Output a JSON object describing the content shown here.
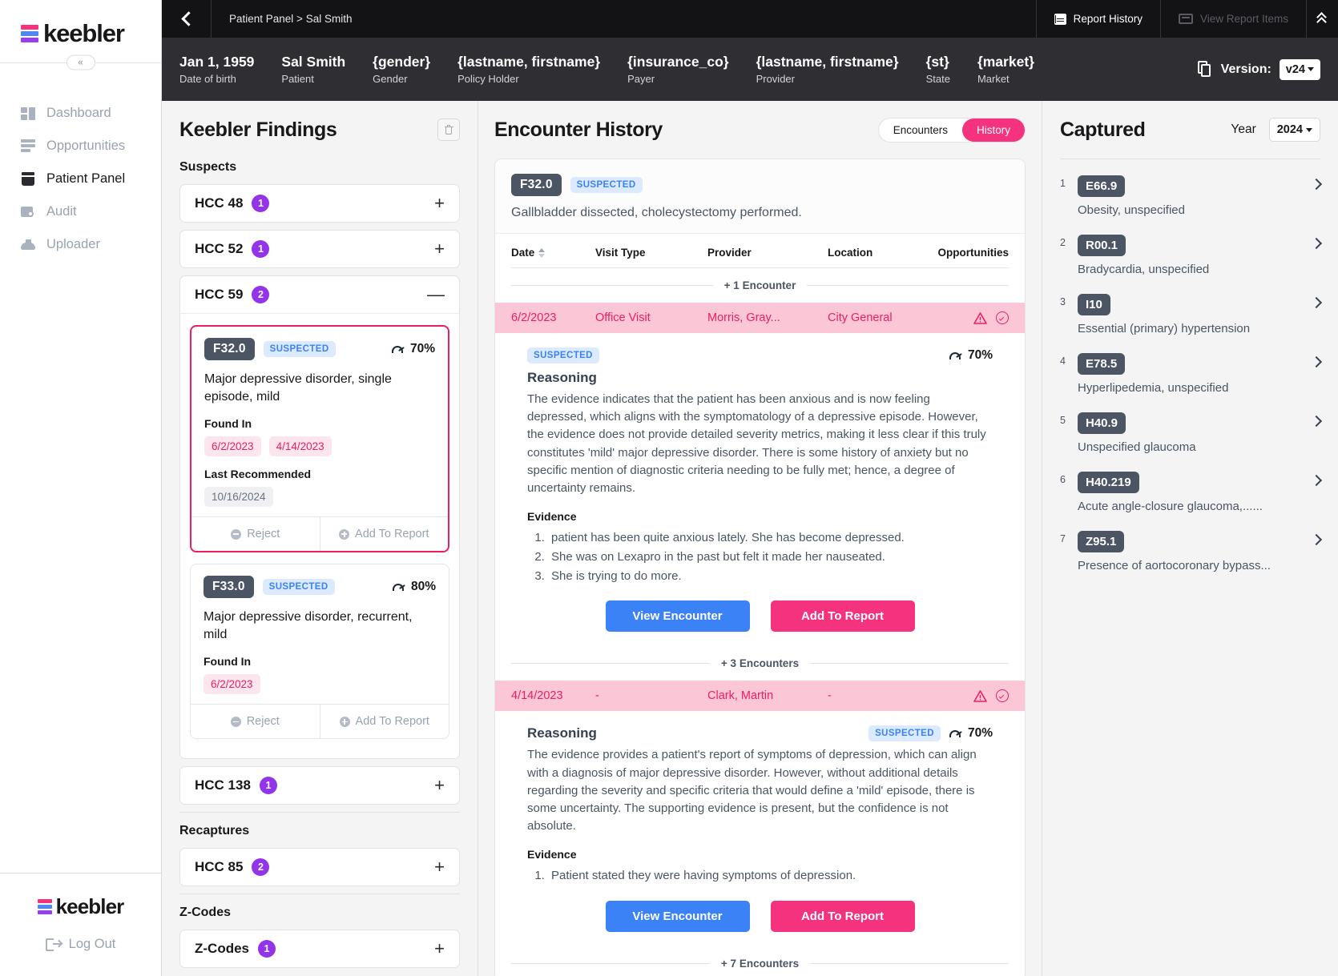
{
  "sidebar": {
    "logo_text": "keebler",
    "collapse_icon": "chevron-double-left-icon",
    "items": [
      {
        "label": "Dashboard",
        "icon": "dashboard-icon"
      },
      {
        "label": "Opportunities",
        "icon": "opportunities-icon"
      },
      {
        "label": "Patient Panel",
        "icon": "patient-panel-icon"
      },
      {
        "label": "Audit",
        "icon": "audit-icon"
      },
      {
        "label": "Uploader",
        "icon": "uploader-icon"
      }
    ],
    "footer_logo_text": "keebler",
    "logout_label": "Log Out"
  },
  "topbar": {
    "back_icon": "chevron-left-icon",
    "breadcrumb": "Patient Panel > Sal Smith",
    "report_history_label": "Report History",
    "report_history_icon": "report-history-icon",
    "view_report_items_label": "View Report Items",
    "view_report_items_icon": "view-report-items-icon",
    "collapse_icon": "chevron-double-up-icon"
  },
  "patient": {
    "fields": [
      {
        "value": "Jan 1, 1959",
        "label": "Date of birth"
      },
      {
        "value": "Sal Smith",
        "label": "Patient"
      },
      {
        "value": "{gender}",
        "label": "Gender"
      },
      {
        "value": "{lastname, firstname}",
        "label": "Policy Holder"
      },
      {
        "value": "{insurance_co}",
        "label": "Payer"
      },
      {
        "value": "{lastname, firstname}",
        "label": "Provider"
      },
      {
        "value": "{st}",
        "label": "State"
      },
      {
        "value": "{market}",
        "label": "Market"
      }
    ],
    "version_icon": "documents-icon",
    "version_label": "Version:",
    "version_value": "v24"
  },
  "findings": {
    "title": "Keebler Findings",
    "trash_icon": "trash-icon",
    "sections": [
      {
        "label": "Suspects",
        "rows": [
          {
            "name": "HCC 48",
            "count": "1",
            "toggle": "+",
            "expanded": false
          },
          {
            "name": "HCC 52",
            "count": "1",
            "toggle": "+",
            "expanded": false
          },
          {
            "name": "HCC 59",
            "count": "2",
            "toggle": "—",
            "expanded": true
          },
          {
            "name": "HCC 138",
            "count": "1",
            "toggle": "+",
            "expanded": false
          }
        ]
      },
      {
        "label": "Recaptures",
        "rows": [
          {
            "name": "HCC 85",
            "count": "2",
            "toggle": "+",
            "expanded": false
          }
        ]
      },
      {
        "label": "Z-Codes",
        "rows": [
          {
            "name": "Z-Codes",
            "count": "1",
            "toggle": "+",
            "expanded": false
          }
        ]
      }
    ],
    "cards": [
      {
        "code": "F32.0",
        "status": "SUSPECTED",
        "confidence": "70%",
        "description": "Major depressive disorder, single episode, mild",
        "found_in_label": "Found In",
        "found_in": [
          "6/2/2023",
          "4/14/2023"
        ],
        "last_recommended_label": "Last Recommended",
        "last_recommended": "10/16/2024",
        "reject_label": "Reject",
        "add_label": "Add To Report",
        "selected": true
      },
      {
        "code": "F33.0",
        "status": "SUSPECTED",
        "confidence": "80%",
        "description": "Major depressive disorder, recurrent, mild",
        "found_in_label": "Found In",
        "found_in": [
          "6/2/2023"
        ],
        "last_recommended_label": "",
        "last_recommended": "",
        "reject_label": "Reject",
        "add_label": "Add To Report",
        "selected": false
      }
    ]
  },
  "history": {
    "title": "Encounter History",
    "tabs": [
      {
        "label": "Encounters",
        "active": false
      },
      {
        "label": "History",
        "active": true
      }
    ],
    "header": {
      "code": "F32.0",
      "status": "SUSPECTED",
      "note": "Gallbladder dissected, cholecystectomy performed."
    },
    "columns": [
      "Date",
      "Visit Type",
      "Provider",
      "Location",
      "Opportunities"
    ],
    "groups": [
      {
        "divider": "+ 1 Encounter",
        "row": {
          "date": "6/2/2023",
          "visit_type": "Office Visit",
          "provider": "Morris, Gray...",
          "location": "City General",
          "warn_icon": "warning-triangle-icon",
          "check_icon": "check-circle-icon"
        },
        "reasoning": {
          "status": "SUSPECTED",
          "status_position": "above",
          "confidence": "70%",
          "title": "Reasoning",
          "text": "The evidence indicates that the patient has been anxious and is now feeling depressed, which aligns with the symptomatology of a depressive episode. However, the evidence does not provide detailed severity metrics, making it less clear if this truly constitutes 'mild' major depressive disorder. There is some history of anxiety but no specific mention of diagnostic criteria needing to be fully met; hence, a degree of uncertainty remains.",
          "evidence_label": "Evidence",
          "evidence": [
            "patient has been quite anxious lately. She has become depressed.",
            "She was on Lexapro in the past but felt it made her nauseated.",
            "She is trying to do more."
          ],
          "view_label": "View Encounter",
          "add_label": "Add To Report"
        }
      },
      {
        "divider": "+ 3 Encounters",
        "row": {
          "date": "4/14/2023",
          "visit_type": "-",
          "provider": "Clark, Martin",
          "location": "-",
          "warn_icon": "warning-triangle-icon",
          "check_icon": "check-circle-icon"
        },
        "reasoning": {
          "status": "SUSPECTED",
          "status_position": "inline",
          "confidence": "70%",
          "title": "Reasoning",
          "text": "The evidence provides a patient's report of symptoms of depression, which can align with a diagnosis of major depressive disorder. However, without additional details regarding the severity and specific criteria that would define a 'mild' episode, there is some uncertainty. The supporting evidence is present, but the confidence is not absolute.",
          "evidence_label": "Evidence",
          "evidence": [
            "Patient stated they were having symptoms of depression."
          ],
          "view_label": "View Encounter",
          "add_label": "Add To Report"
        }
      }
    ],
    "footer_divider": "+ 7 Encounters"
  },
  "captured": {
    "title": "Captured",
    "year_label": "Year",
    "year_value": "2024",
    "items": [
      {
        "num": "1",
        "code": "E66.9",
        "desc": "Obesity, unspecified"
      },
      {
        "num": "2",
        "code": "R00.1",
        "desc": "Bradycardia, unspecified"
      },
      {
        "num": "3",
        "code": "I10",
        "desc": "Essential (primary) hypertension"
      },
      {
        "num": "4",
        "code": "E78.5",
        "desc": "Hyperlipedemia, unspecified"
      },
      {
        "num": "5",
        "code": "H40.9",
        "desc": "Unspecified glaucoma"
      },
      {
        "num": "6",
        "code": "H40.219",
        "desc": "Acute angle-closure glaucoma,......"
      },
      {
        "num": "7",
        "code": "Z95.1",
        "desc": "Presence of aortocoronary bypass..."
      }
    ]
  },
  "colors": {
    "brand_pink": "#f5327e",
    "accent_blue": "#3b82f6",
    "badge_purple": "#9333ea",
    "code_chip": "#4b5563",
    "row_highlight": "#fbc6d5",
    "selected_border": "#ec1e63"
  }
}
